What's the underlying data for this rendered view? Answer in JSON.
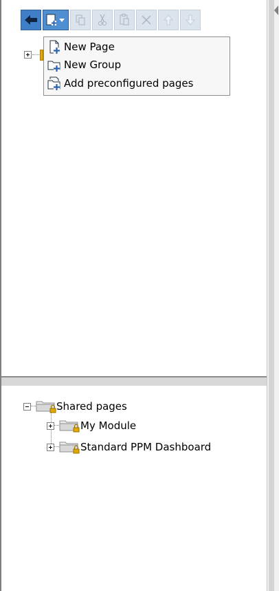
{
  "menu": {
    "items": [
      {
        "label": "New Page",
        "icon": "new-page-icon"
      },
      {
        "label": "New Group",
        "icon": "new-group-icon"
      },
      {
        "label": "Add preconfigured pages",
        "icon": "add-preconfigured-icon"
      }
    ]
  },
  "toolbar": {
    "buttons": [
      "back-icon",
      "new-item-icon",
      "copy-icon",
      "cut-icon",
      "paste-icon",
      "delete-icon",
      "move-up-icon",
      "move-down-icon"
    ]
  },
  "shared_tree": {
    "root": "Shared pages",
    "children": [
      "My Module",
      "Standard PPM Dashboard"
    ]
  },
  "colors": {
    "accent": "#3f7fc7",
    "toolbar_disabled": "#dbe3ed",
    "folder": "#d8d8d8",
    "lock": "#e0a800"
  }
}
